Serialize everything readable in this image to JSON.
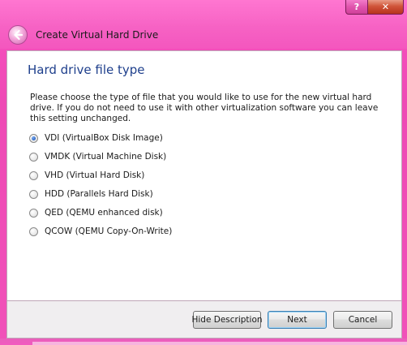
{
  "window": {
    "title": "Create Virtual Hard Drive",
    "help_button": "?",
    "close_button": "✕",
    "accent_color": "#f04ab4"
  },
  "page": {
    "heading": "Hard drive file type",
    "description": "Please choose the type of file that you would like to use for the new virtual hard drive. If you do not need to use it with other virtualization software you can leave this setting unchanged."
  },
  "options": [
    {
      "label": "VDI (VirtualBox Disk Image)",
      "selected": true
    },
    {
      "label": "VMDK (Virtual Machine Disk)",
      "selected": false
    },
    {
      "label": "VHD (Virtual Hard Disk)",
      "selected": false
    },
    {
      "label": "HDD (Parallels Hard Disk)",
      "selected": false
    },
    {
      "label": "QED (QEMU enhanced disk)",
      "selected": false
    },
    {
      "label": "QCOW (QEMU Copy-On-Write)",
      "selected": false
    }
  ],
  "buttons": {
    "hide_description": "Hide Description",
    "next": "Next",
    "cancel": "Cancel"
  },
  "icons": {
    "back": "back-arrow-icon",
    "radio_selected": "radio-selected-icon",
    "radio_unselected": "radio-unselected-icon"
  }
}
